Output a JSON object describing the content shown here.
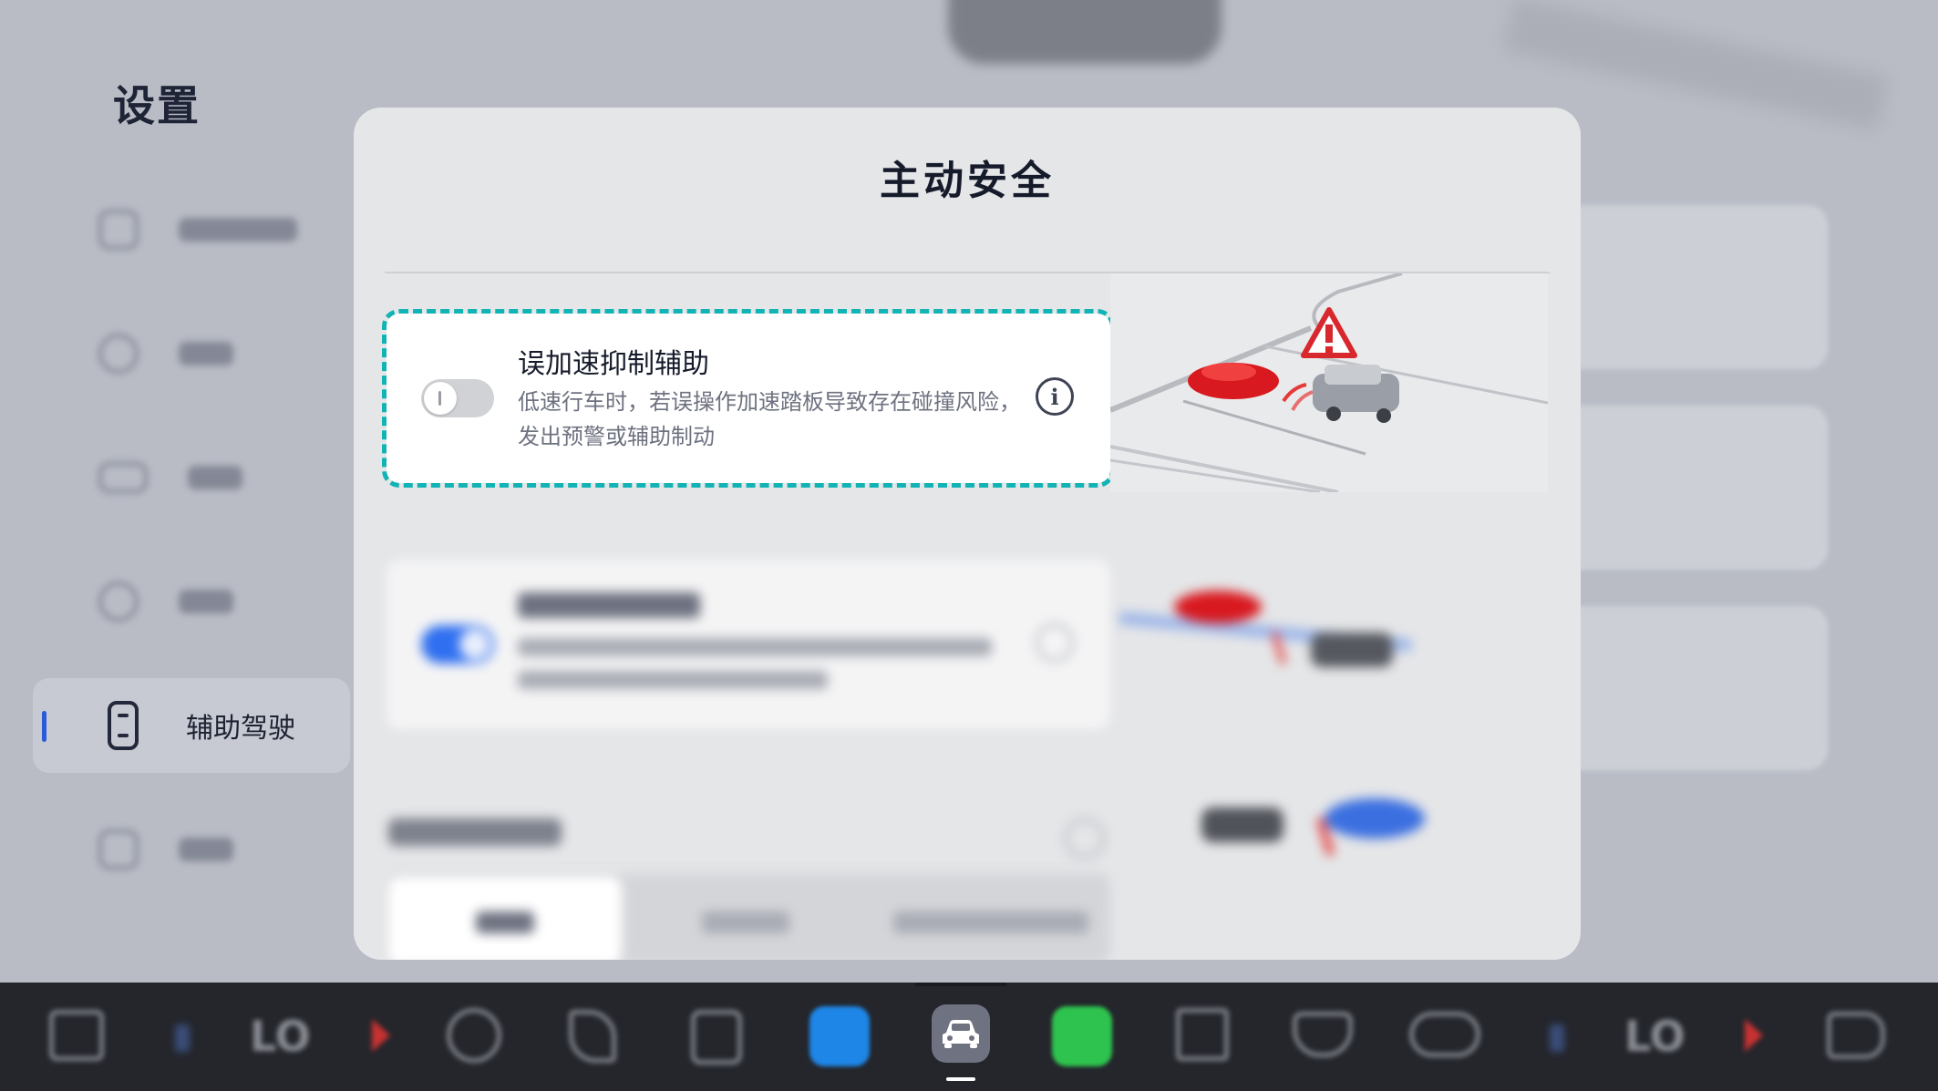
{
  "page": {
    "title": "设置"
  },
  "sidebar": {
    "active_item": {
      "label": "辅助驾驶",
      "icon": "vehicle-assist-icon"
    }
  },
  "modal": {
    "title": "主动安全",
    "feature": {
      "title": "误加速抑制辅助",
      "description": "低速行车时，若误操作加速踏板导致存在碰撞风险，发出预警或辅助制动",
      "toggle_state": "off",
      "info_icon": "info-icon"
    }
  },
  "taskbar": {
    "lo_left": "LO",
    "lo_right": "LO",
    "active_app": "car-settings-icon"
  },
  "colors": {
    "accent_teal": "#12b3b4",
    "warning_red": "#d8272d",
    "toggle_on_blue": "#2f6ff0",
    "phone_green": "#2ec34e",
    "video_blue": "#1e86e6"
  }
}
